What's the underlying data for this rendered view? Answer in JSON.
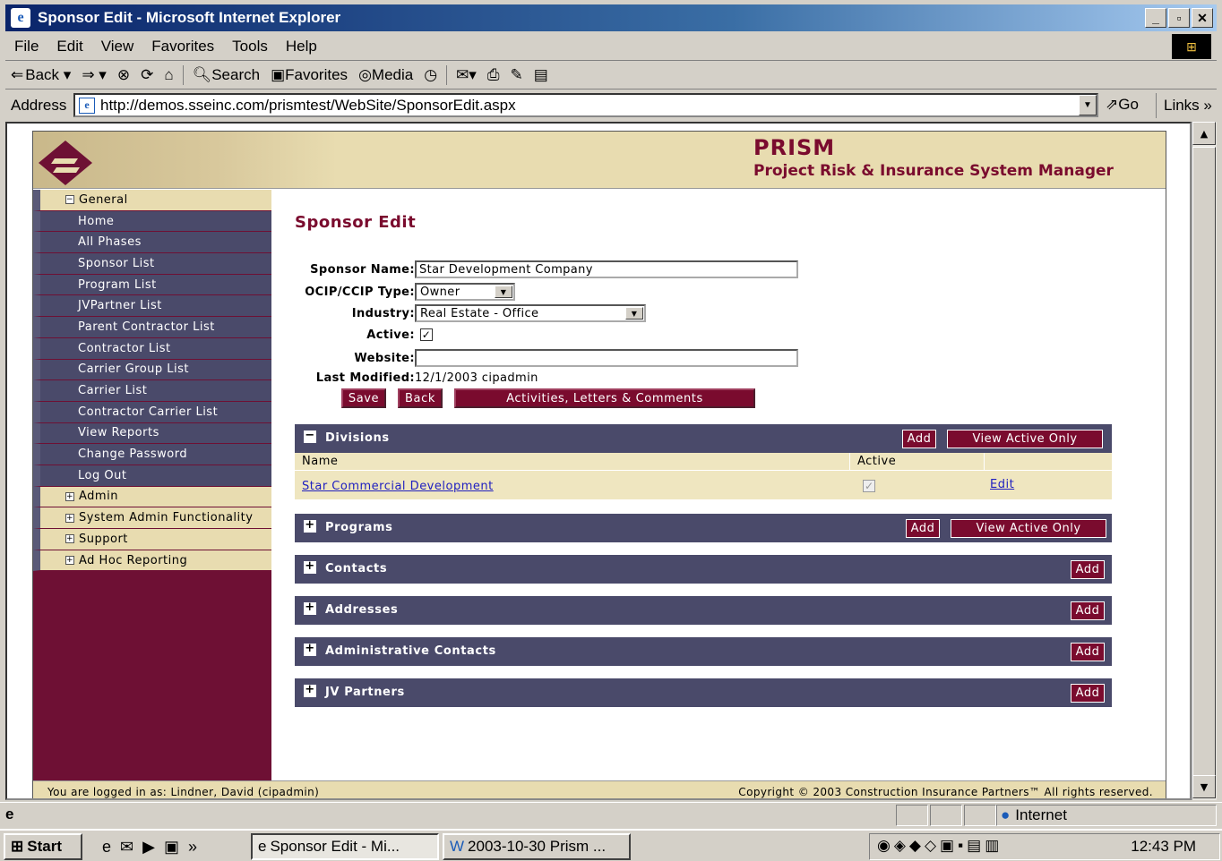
{
  "window": {
    "title": "Sponsor Edit - Microsoft Internet Explorer"
  },
  "menu": [
    "File",
    "Edit",
    "View",
    "Favorites",
    "Tools",
    "Help"
  ],
  "toolbar": {
    "back": "Back",
    "search": "Search",
    "favorites": "Favorites",
    "media": "Media"
  },
  "address": {
    "label": "Address",
    "url": "http://demos.sseinc.com/prismtest/WebSite/SponsorEdit.aspx",
    "go": "Go",
    "links": "Links"
  },
  "banner": {
    "title": "PRISM",
    "subtitle": "Project Risk & Insurance System Manager"
  },
  "sidebar": {
    "general": "General",
    "items": [
      "Home",
      "All Phases",
      "Sponsor List",
      "Program List",
      "JVPartner List",
      "Parent Contractor List",
      "Contractor List",
      "Carrier Group List",
      "Carrier List",
      "Contractor Carrier List",
      "View Reports",
      "Change Password",
      "Log Out"
    ],
    "groups": [
      "Admin",
      "System Admin Functionality",
      "Support",
      "Ad Hoc Reporting"
    ]
  },
  "page": {
    "title": "Sponsor Edit"
  },
  "form": {
    "sponsor_name_label": "Sponsor Name:",
    "sponsor_name": "Star Development Company",
    "type_label": "OCIP/CCIP Type:",
    "type_value": "Owner",
    "industry_label": "Industry:",
    "industry_value": "Real Estate - Office",
    "active_label": "Active:",
    "active_checked": true,
    "website_label": "Website:",
    "website_value": "",
    "modified_label": "Last Modified:",
    "modified_value": "12/1/2003 cipadmin"
  },
  "buttons": {
    "save": "Save",
    "back": "Back",
    "activities": "Activities, Letters & Comments",
    "add": "Add",
    "view_active": "View Active Only",
    "edit": "Edit"
  },
  "sections": {
    "divisions": "Divisions",
    "programs": "Programs",
    "contacts": "Contacts",
    "addresses": "Addresses",
    "admin_contacts": "Administrative Contacts",
    "jv_partners": "JV Partners"
  },
  "divisions_table": {
    "columns": [
      "Name",
      "Active"
    ],
    "rows": [
      {
        "name": "Star Commercial Development",
        "active": true
      }
    ]
  },
  "footer": {
    "logged_in": "You are logged in as: Lindner, David (cipadmin)",
    "copyright": "Copyright © 2003 Construction Insurance Partners™ All rights reserved."
  },
  "status": {
    "zone": "Internet"
  },
  "taskbar": {
    "start": "start",
    "task1": "Sponsor Edit - Mi...",
    "task2": "2003-10-30 Prism ...",
    "time": "12:43 PM"
  }
}
